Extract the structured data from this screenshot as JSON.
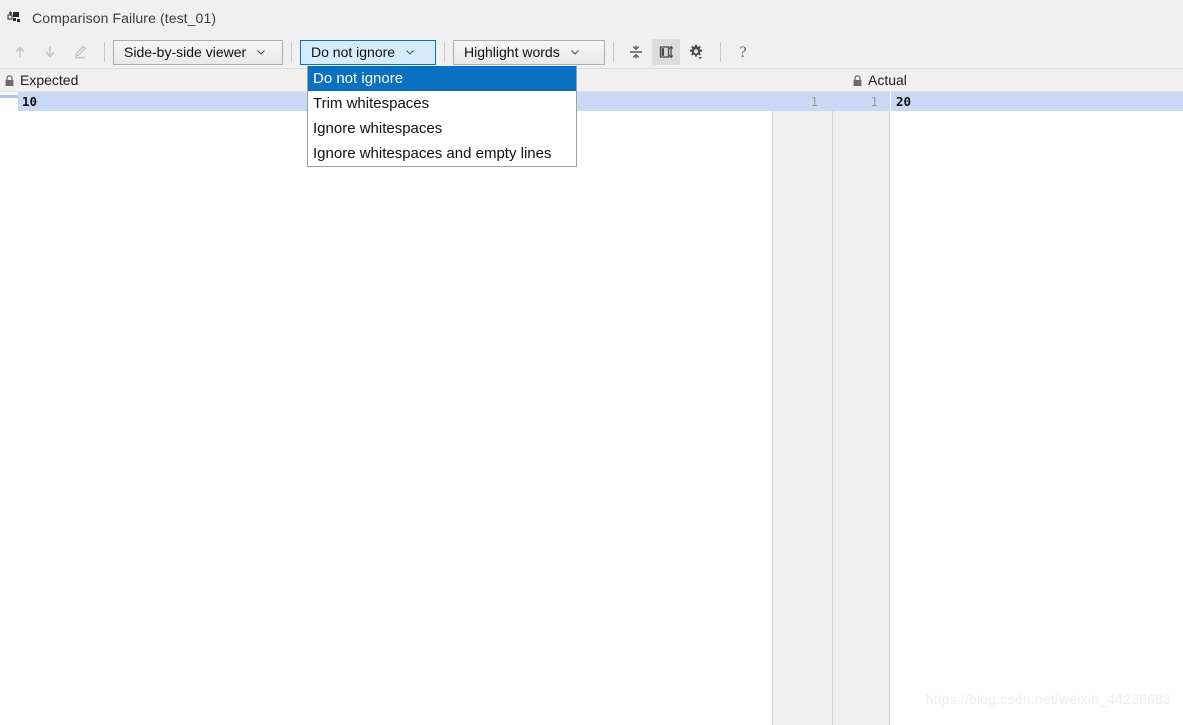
{
  "window": {
    "title": "Comparison Failure (test_01)",
    "icon": "diff-window-icon"
  },
  "toolbar": {
    "prev_icon": "arrow-up-icon",
    "next_icon": "arrow-down-icon",
    "edit_icon": "pencil-edit-icon",
    "viewer_select": {
      "value": "Side-by-side viewer",
      "chevron": "chevron-down-icon"
    },
    "ignore_select": {
      "value": "Do not ignore",
      "chevron": "chevron-down-icon",
      "expanded": true,
      "options": [
        "Do not ignore",
        "Trim whitespaces",
        "Ignore whitespaces",
        "Ignore whitespaces and empty lines"
      ],
      "selected_index": 0
    },
    "highlight_select": {
      "value": "Highlight words",
      "chevron": "chevron-down-icon"
    },
    "collapse_icon": "collapse-unchanged-fragments-icon",
    "compare_panes_icon": "synchronize-panes-icon",
    "settings_icon": "gear-settings-icon",
    "help_icon": "help-question-icon"
  },
  "columns": {
    "expected": {
      "label": "Expected",
      "lock_icon": "lock-icon"
    },
    "actual": {
      "label": "Actual",
      "lock_icon": "lock-icon"
    }
  },
  "diff": {
    "rows": [
      {
        "expected": "10",
        "actual": "20",
        "line_left": "1",
        "line_right": "1"
      }
    ]
  },
  "watermark": {
    "text": "https://blog.csdn.net/weixin_44238683"
  },
  "colors": {
    "accent_blue": "#0a70c0",
    "combo_active_fill": "#d6ebfb",
    "row_highlight": "#c9d8f5",
    "chrome_gray": "#f0f0f0",
    "gutter_gray": "#efefef"
  }
}
